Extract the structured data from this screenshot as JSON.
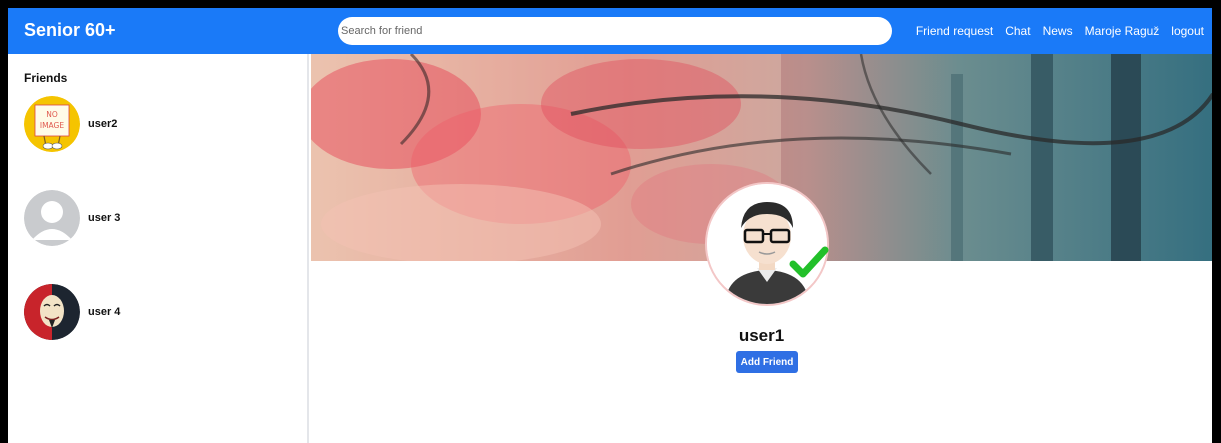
{
  "app": {
    "brand": "Senior 60+"
  },
  "search": {
    "placeholder": "Search for friend"
  },
  "nav": {
    "links": [
      "Friend request",
      "Chat",
      "News",
      "Maroje Raguž",
      "logout"
    ]
  },
  "sidebar": {
    "title": "Friends",
    "friends": [
      {
        "name": "user2",
        "avatar": "no-image-avatar",
        "avatar_text_1": "NO",
        "avatar_text_2": "IMAGE"
      },
      {
        "name": "user 3",
        "avatar": "default-silhouette-avatar"
      },
      {
        "name": "user 4",
        "avatar": "masked-face-avatar"
      }
    ]
  },
  "profile": {
    "name": "user1",
    "add_friend_label": "Add Friend",
    "cover": "autumn-forest-cover-image",
    "avatar": "cartoon-man-glasses-avatar",
    "verified": true
  },
  "colors": {
    "navbar": "#1a7af8",
    "button": "#2f6fe4",
    "verified_check": "#22c02a"
  }
}
